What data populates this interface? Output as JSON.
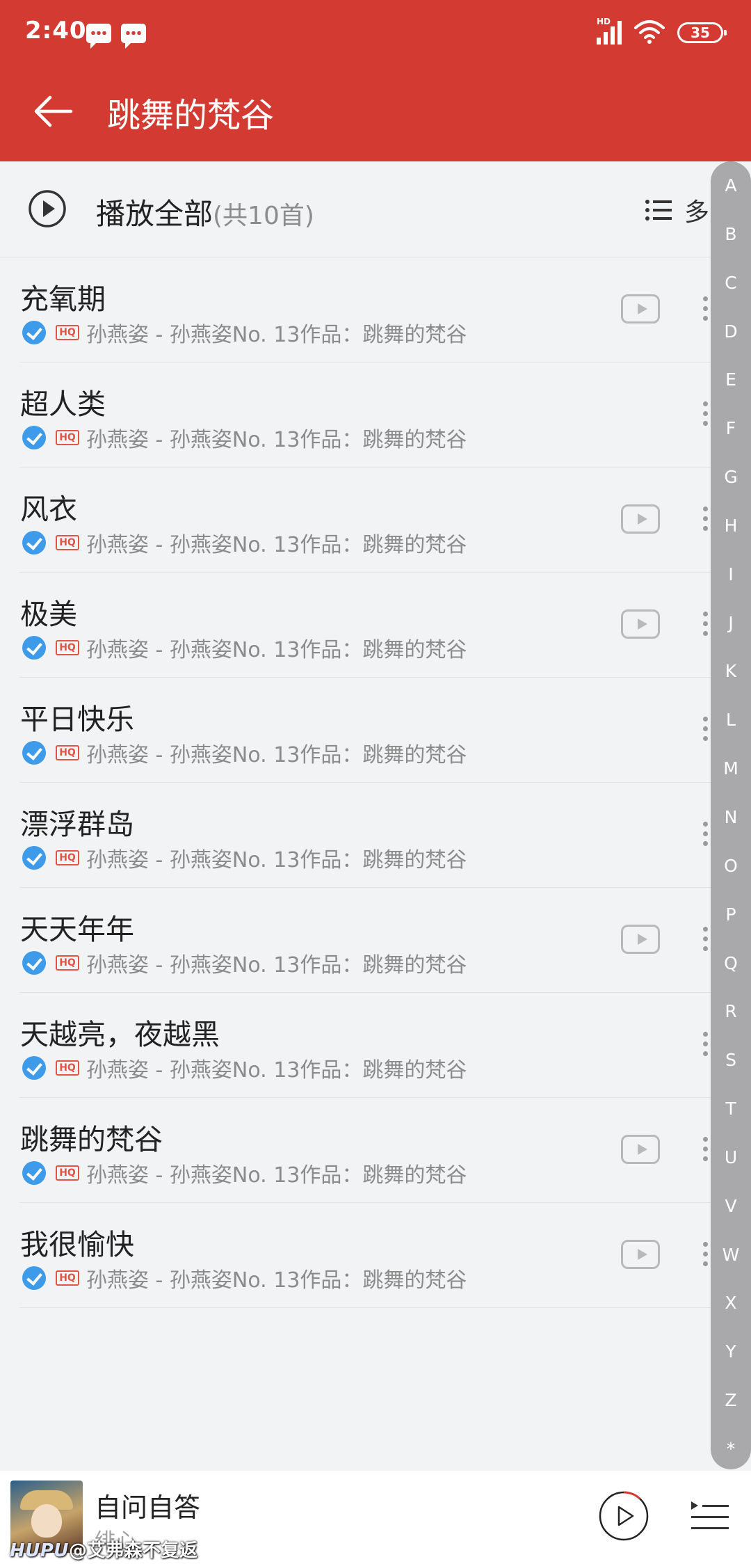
{
  "status": {
    "time": "2:40",
    "network": "HD",
    "battery": "35"
  },
  "header": {
    "title": "跳舞的梵谷"
  },
  "playall": {
    "label": "播放全部",
    "count": "(共10首)",
    "multi_select": "多选"
  },
  "songs": [
    {
      "title": "充氧期",
      "artist_album": "孙燕姿 - 孙燕姿No. 13作品：跳舞的梵谷",
      "has_mv": true
    },
    {
      "title": "超人类",
      "artist_album": "孙燕姿 - 孙燕姿No. 13作品：跳舞的梵谷",
      "has_mv": false
    },
    {
      "title": "风衣",
      "artist_album": "孙燕姿 - 孙燕姿No. 13作品：跳舞的梵谷",
      "has_mv": true
    },
    {
      "title": "极美",
      "artist_album": "孙燕姿 - 孙燕姿No. 13作品：跳舞的梵谷",
      "has_mv": true
    },
    {
      "title": "平日快乐",
      "artist_album": "孙燕姿 - 孙燕姿No. 13作品：跳舞的梵谷",
      "has_mv": false
    },
    {
      "title": "漂浮群岛",
      "artist_album": "孙燕姿 - 孙燕姿No. 13作品：跳舞的梵谷",
      "has_mv": false
    },
    {
      "title": "天天年年",
      "artist_album": "孙燕姿 - 孙燕姿No. 13作品：跳舞的梵谷",
      "has_mv": true
    },
    {
      "title": "天越亮，夜越黑",
      "artist_album": "孙燕姿 - 孙燕姿No. 13作品：跳舞的梵谷",
      "has_mv": false
    },
    {
      "title": "跳舞的梵谷",
      "artist_album": "孙燕姿 - 孙燕姿No. 13作品：跳舞的梵谷",
      "has_mv": true
    },
    {
      "title": "我很愉快",
      "artist_album": "孙燕姿 - 孙燕姿No. 13作品：跳舞的梵谷",
      "has_mv": true
    }
  ],
  "quality_badge": "HQ",
  "index_letters": [
    "A",
    "B",
    "C",
    "D",
    "E",
    "F",
    "G",
    "H",
    "I",
    "J",
    "K",
    "L",
    "M",
    "N",
    "O",
    "P",
    "Q",
    "R",
    "S",
    "T",
    "U",
    "V",
    "W",
    "X",
    "Y",
    "Z",
    "*"
  ],
  "player": {
    "song": "自问自答",
    "artist": "绯心"
  },
  "watermark": {
    "brand": "HUPU",
    "text": "@艾弗森不复返"
  },
  "colors": {
    "accent": "#d33a31",
    "check": "#3d9be9",
    "hq": "#e25348",
    "index_bar": "#a9a9ab"
  }
}
